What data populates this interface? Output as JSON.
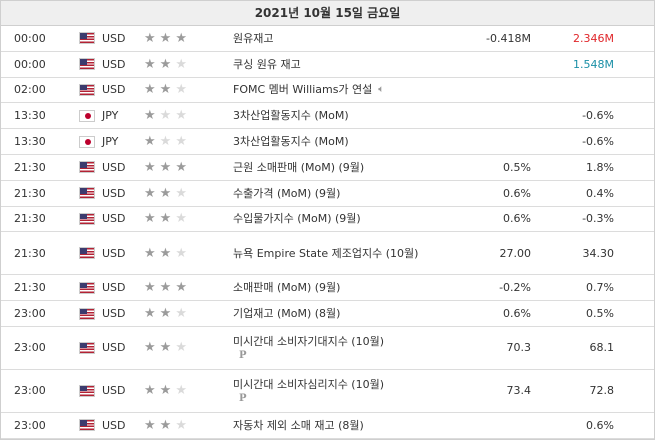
{
  "header": {
    "date": "2021년 10월 15일 금요일"
  },
  "colors": {
    "red": "#e0262a",
    "teal": "#1a8fa6",
    "star_on": "#9b9b9b",
    "star_off": "#dadada"
  },
  "rows": [
    {
      "time": "00:00",
      "flag": "us-flag-icon",
      "currency": "USD",
      "stars": 3,
      "event": "원유재고",
      "previous": "-0.418M",
      "forecast": "2.346M",
      "forecast_color": "red",
      "size": "h1"
    },
    {
      "time": "00:00",
      "flag": "us-flag-icon",
      "currency": "USD",
      "stars": 2,
      "event": "쿠싱 원유 재고",
      "previous": "",
      "forecast": "1.548M",
      "forecast_color": "teal",
      "size": "h1"
    },
    {
      "time": "02:00",
      "flag": "us-flag-icon",
      "currency": "USD",
      "stars": 2,
      "event": "FOMC 멤버 Williams가 연설",
      "previous": "",
      "forecast": "",
      "speaker": true,
      "size": "h1"
    },
    {
      "time": "13:30",
      "flag": "jp-flag-icon",
      "currency": "JPY",
      "stars": 1,
      "event": "3차산업활동지수 (MoM)",
      "previous": "",
      "forecast": "-0.6%",
      "size": "h1"
    },
    {
      "time": "13:30",
      "flag": "jp-flag-icon",
      "currency": "JPY",
      "stars": 1,
      "event": "3차산업활동지수 (MoM)",
      "previous": "",
      "forecast": "-0.6%",
      "size": "h1"
    },
    {
      "time": "21:30",
      "flag": "us-flag-icon",
      "currency": "USD",
      "stars": 3,
      "event": "근원 소매판매 (MoM) (9월)",
      "previous": "0.5%",
      "forecast": "1.8%",
      "size": "h1"
    },
    {
      "time": "21:30",
      "flag": "us-flag-icon",
      "currency": "USD",
      "stars": 2,
      "event": "수출가격 (MoM) (9월)",
      "previous": "0.6%",
      "forecast": "0.4%",
      "size": "h1"
    },
    {
      "time": "21:30",
      "flag": "us-flag-icon",
      "currency": "USD",
      "stars": 2,
      "event": "수입물가지수 (MoM) (9월)",
      "previous": "0.6%",
      "forecast": "-0.3%",
      "size": "h1"
    },
    {
      "time": "21:30",
      "flag": "us-flag-icon",
      "currency": "USD",
      "stars": 2,
      "event": "뉴욕 Empire State 제조업지수 (10월)",
      "previous": "27.00",
      "forecast": "34.30",
      "size": "h2"
    },
    {
      "time": "21:30",
      "flag": "us-flag-icon",
      "currency": "USD",
      "stars": 3,
      "event": "소매판매 (MoM) (9월)",
      "previous": "-0.2%",
      "forecast": "0.7%",
      "size": "h1"
    },
    {
      "time": "23:00",
      "flag": "us-flag-icon",
      "currency": "USD",
      "stars": 2,
      "event": "기업재고 (MoM) (8월)",
      "previous": "0.6%",
      "forecast": "0.5%",
      "size": "h1"
    },
    {
      "time": "23:00",
      "flag": "us-flag-icon",
      "currency": "USD",
      "stars": 2,
      "event": "미시간대 소비자기대지수 (10월)",
      "previous": "70.3",
      "forecast": "68.1",
      "preliminary": "P",
      "size": "h2"
    },
    {
      "time": "23:00",
      "flag": "us-flag-icon",
      "currency": "USD",
      "stars": 2,
      "event": "미시간대 소비자심리지수 (10월)",
      "previous": "73.4",
      "forecast": "72.8",
      "preliminary": "P",
      "size": "h2"
    },
    {
      "time": "23:00",
      "flag": "us-flag-icon",
      "currency": "USD",
      "stars": 2,
      "event": "자동차 제외 소매 재고 (8월)",
      "previous": "",
      "forecast": "0.6%",
      "size": "h1"
    }
  ]
}
